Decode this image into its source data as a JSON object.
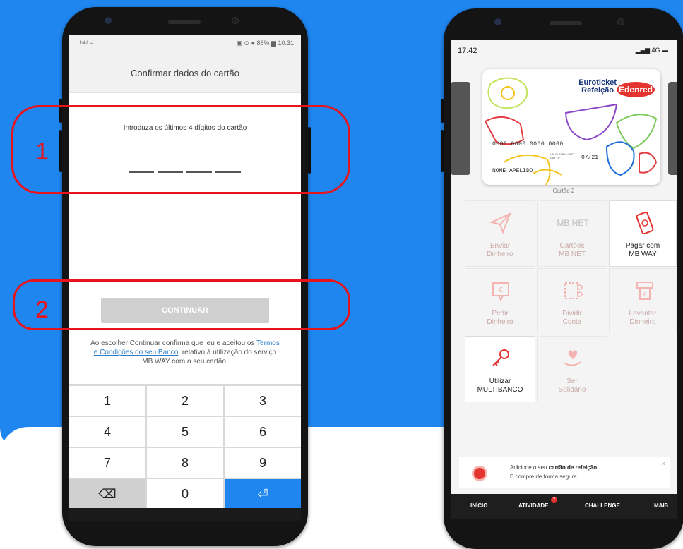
{
  "screen1": {
    "status_left": "ᴴʳ•ᴸᴵ ≡",
    "status_right": "▣ ⊙ ● 88% ▆ 10:31",
    "title": "Confirmar dados do cartão",
    "instruction": "Introduza os últimos 4 dígitos do cartão",
    "continue_label": "CONTINUAR",
    "terms_prefix": "Ao escolher Continuar confirma que leu e aceitou os ",
    "terms_link": "Termos e Condições do seu Banco",
    "terms_suffix": ", relativo à utilização do serviço MB WAY com o seu cartão.",
    "keys": [
      "1",
      "2",
      "3",
      "4",
      "5",
      "6",
      "7",
      "8",
      "9",
      "⌫",
      "0",
      "⏎"
    ]
  },
  "annotations": {
    "first": "1",
    "second": "2"
  },
  "screen2": {
    "time": "17:42",
    "signal": "▂▄▆ 4G ▬",
    "card": {
      "brand_line1": "Euroticket",
      "brand_line2": "Refeição",
      "logo": "Edenred",
      "number": "0000 0000 0000 0000",
      "expiry_label": "VALID THRU LAST DAY OF",
      "expiry": "07/21",
      "name": "NOME APELIDO"
    },
    "card_caption": "Cartão 2",
    "tiles": [
      {
        "l1": "Enviar",
        "l2": "Dinheiro"
      },
      {
        "l1": "Cartões",
        "l2": "MB NET"
      },
      {
        "l1": "Pagar com",
        "l2": "MB WAY"
      },
      {
        "l1": "Pedir",
        "l2": "Dinheiro"
      },
      {
        "l1": "Dividir",
        "l2": "Conta"
      },
      {
        "l1": "Levantar",
        "l2": "Dinheiro"
      },
      {
        "l1": "Utilizar",
        "l2": "MULTIBANCO"
      },
      {
        "l1": "Ser",
        "l2": "Solidário"
      }
    ],
    "mbnet_icon_text": "MB NET",
    "banner": {
      "prefix": "Adicione o seu ",
      "bold": "cartão de refeição",
      "line2": "E compre de forma segura.",
      "close": "×"
    },
    "nav": [
      {
        "label": "INÍCIO"
      },
      {
        "label": "ATIVIDADE",
        "badge": "2"
      },
      {
        "label": "CHALLENGE"
      },
      {
        "label": "MAIS"
      }
    ]
  },
  "colors": {
    "brand_blue": "#1f86f0",
    "annotation_red": "#e8141b",
    "edenred_red": "#e4342f"
  }
}
